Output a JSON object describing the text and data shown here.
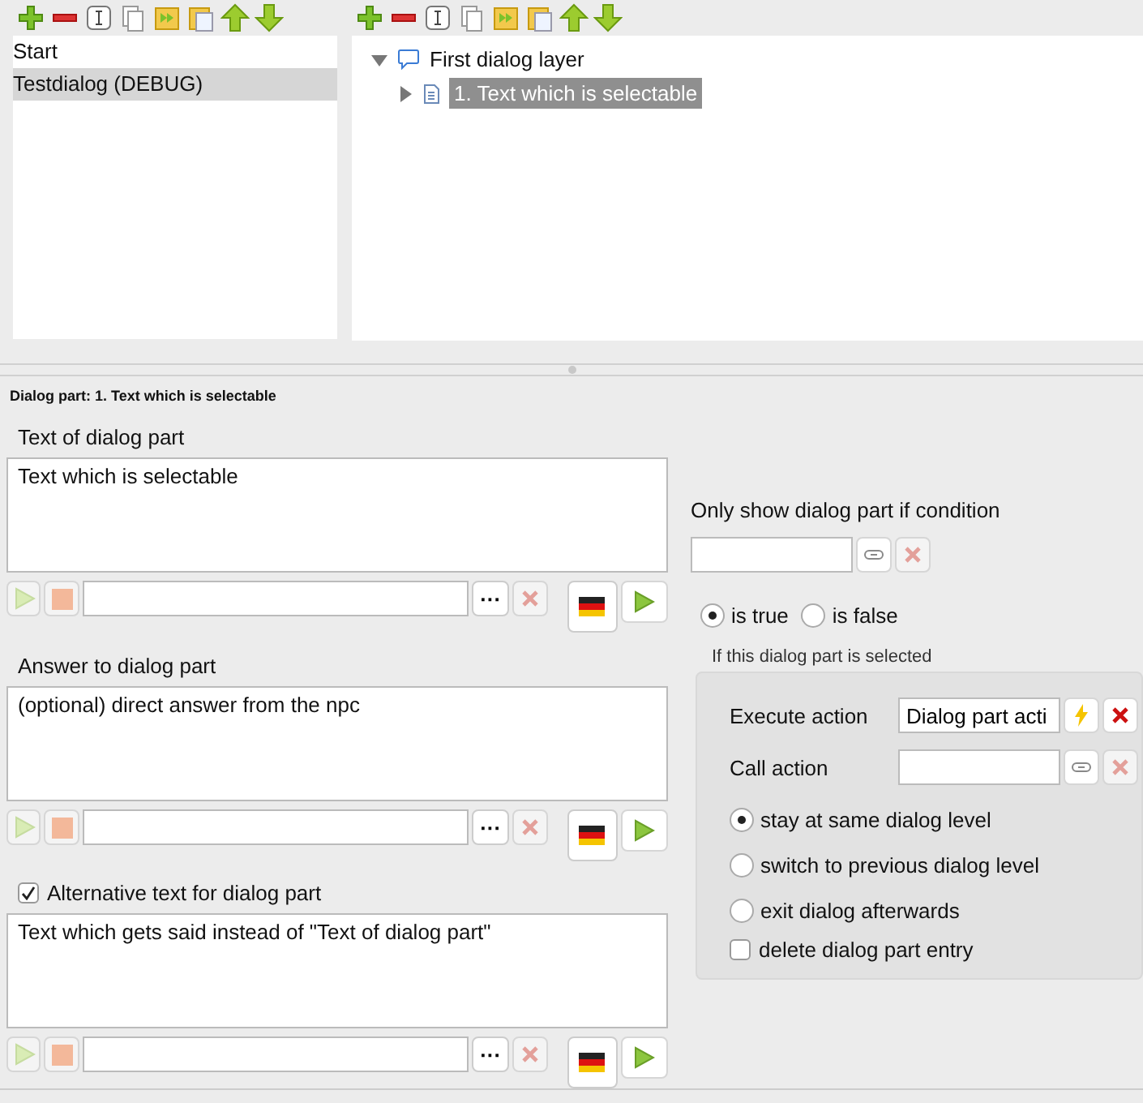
{
  "dialogs": {
    "items": [
      {
        "label": "Start",
        "selected": false
      },
      {
        "label": "Testdialog (DEBUG)",
        "selected": true
      }
    ]
  },
  "tree": {
    "label": "First dialog layer",
    "expanded": true,
    "children": [
      {
        "label": "1. Text which is selectable",
        "selected": true,
        "expanded": false
      }
    ]
  },
  "part_title": "Dialog part: 1. Text which is selectable",
  "sections": [
    {
      "kind": "heading",
      "label": "Text of dialog part",
      "text": "Text which is selectable",
      "browse": "···"
    },
    {
      "kind": "heading",
      "label": "Answer to dialog part",
      "text": "(optional) direct answer from the npc",
      "browse": "···"
    },
    {
      "kind": "checkbox",
      "checked": true,
      "label": "Alternative text for dialog part",
      "text": "Text which gets said instead of \"Text of dialog part\"",
      "browse": "···"
    }
  ],
  "condition": {
    "label": "Only show dialog part if condition",
    "options": [
      {
        "label": "is true",
        "selected": true
      },
      {
        "label": "is false",
        "selected": false
      }
    ]
  },
  "on_select": {
    "label": "If this dialog part is selected",
    "execute_action": {
      "label": "Execute action",
      "value": "Dialog part acti"
    },
    "call_action": {
      "label": "Call action"
    },
    "levels": [
      {
        "label": "stay at same dialog level",
        "selected": true
      },
      {
        "label": "switch to previous dialog level",
        "selected": false
      },
      {
        "label": "exit dialog afterwards",
        "selected": false
      }
    ],
    "delete_entry": {
      "label": "delete dialog part entry",
      "checked": false
    }
  }
}
